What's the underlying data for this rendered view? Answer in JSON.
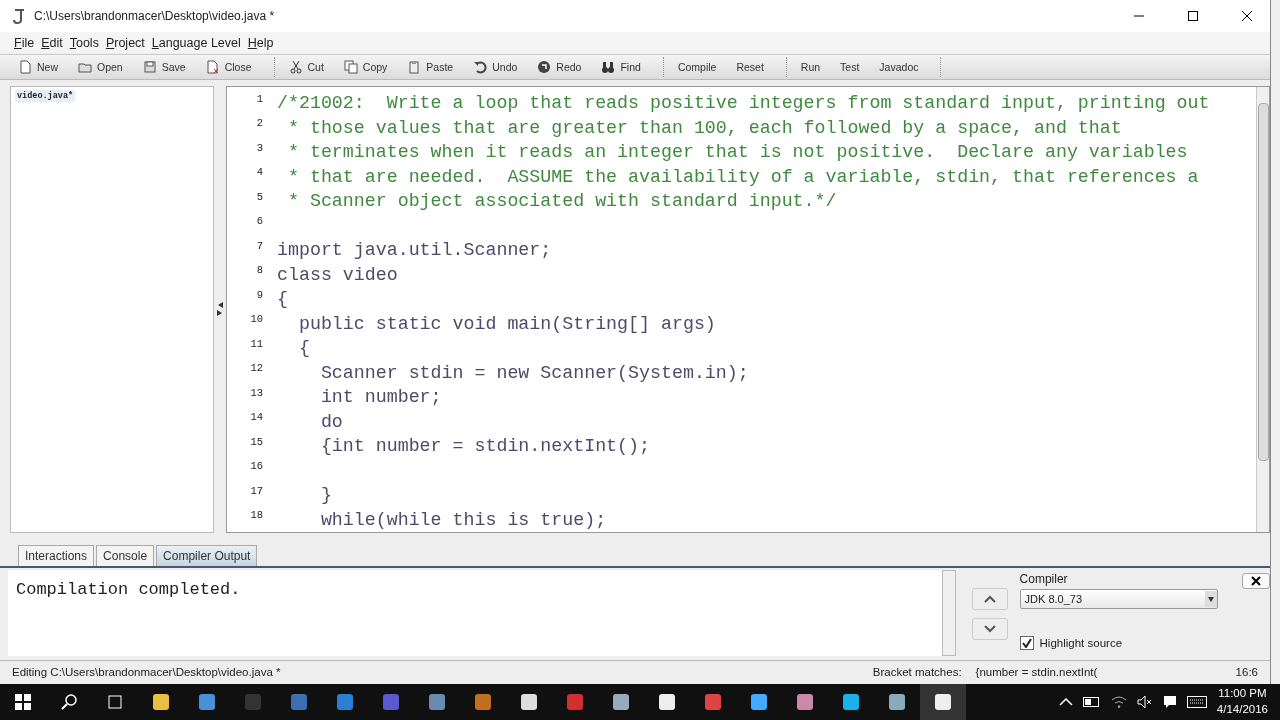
{
  "window": {
    "title": "C:\\Users\\brandonmacer\\Desktop\\video.java *"
  },
  "menu": [
    "File",
    "Edit",
    "Tools",
    "Project",
    "Language Level",
    "Help"
  ],
  "toolbar": [
    [
      {
        "label": "New"
      },
      {
        "label": "Open"
      },
      {
        "label": "Save"
      },
      {
        "label": "Close"
      }
    ],
    [
      {
        "label": "Cut"
      },
      {
        "label": "Copy"
      },
      {
        "label": "Paste"
      },
      {
        "label": "Undo"
      },
      {
        "label": "Redo"
      },
      {
        "label": "Find"
      }
    ],
    [
      {
        "label": "Compile"
      },
      {
        "label": "Reset"
      }
    ],
    [
      {
        "label": "Run"
      },
      {
        "label": "Test"
      },
      {
        "label": "Javadoc"
      }
    ]
  ],
  "documents": [
    {
      "name": "video.java*",
      "selected": true
    }
  ],
  "editor": {
    "lines": [
      {
        "number": "1",
        "kind": "comment",
        "text": "/*21002:  Write a loop that reads positive integers from standard input, printing out"
      },
      {
        "number": "2",
        "kind": "comment",
        "text": " * those values that are greater than 100, each followed by a space, and that"
      },
      {
        "number": "3",
        "kind": "comment",
        "text": " * terminates when it reads an integer that is not positive.  Declare any variables"
      },
      {
        "number": "4",
        "kind": "comment",
        "text": " * that are needed.  ASSUME the availability of a variable, stdin, that references a"
      },
      {
        "number": "5",
        "kind": "comment",
        "text": " * Scanner object associated with standard input.*/"
      },
      {
        "number": "6"
      },
      {
        "number": "7",
        "kind": "code",
        "text": "import java.util.Scanner;"
      },
      {
        "number": "8",
        "kind": "code",
        "text": "class video"
      },
      {
        "number": "9",
        "kind": "code",
        "text": "{"
      },
      {
        "number": "10",
        "kind": "code",
        "text": "  public static void main(String[] args)"
      },
      {
        "number": "11",
        "kind": "code",
        "text": "  {"
      },
      {
        "number": "12",
        "kind": "code",
        "text": "    Scanner stdin = new Scanner(System.in);"
      },
      {
        "number": "13",
        "kind": "code",
        "text": "    int number;"
      },
      {
        "number": "14",
        "kind": "code",
        "text": "    do"
      },
      {
        "number": "15",
        "kind": "code",
        "text": "    {int number = stdin.nextInt();"
      },
      {
        "number": "16"
      },
      {
        "number": "17",
        "kind": "code",
        "text": "    }"
      },
      {
        "number": "18",
        "kind": "code",
        "text": "    while(while this is true);"
      }
    ]
  },
  "tabs": [
    {
      "label": "Interactions",
      "selected": false
    },
    {
      "label": "Console",
      "selected": false
    },
    {
      "label": "Compiler Output",
      "selected": true
    }
  ],
  "output": {
    "text": "Compilation completed."
  },
  "compiler": {
    "label": "Compiler",
    "value": "JDK 8.0_73",
    "highlight_source": {
      "label": "Highlight source",
      "checked": true
    }
  },
  "status_bar": {
    "file": "Editing C:\\Users\\brandonmacer\\Desktop\\video.java *",
    "bracket_label": "Bracket matches:",
    "bracket_value": "{number = stdin.nextInt(",
    "position": "16:6"
  },
  "taskbar": {
    "time": "11:00 PM",
    "date": "4/14/2016"
  }
}
